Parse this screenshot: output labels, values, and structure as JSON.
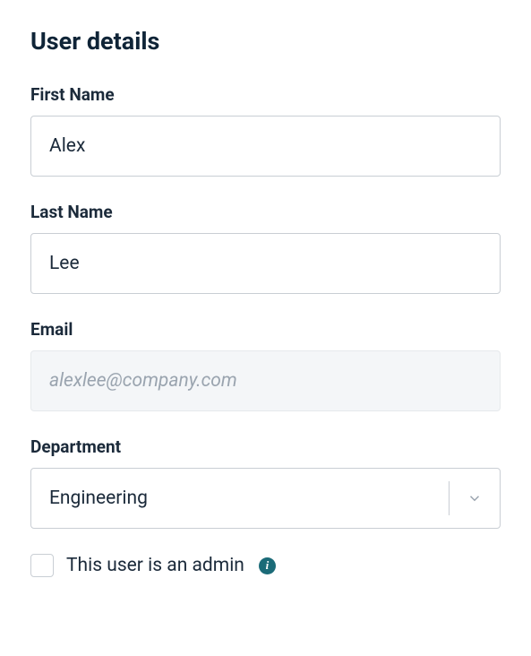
{
  "title": "User details",
  "fields": {
    "first_name": {
      "label": "First Name",
      "value": "Alex"
    },
    "last_name": {
      "label": "Last Name",
      "value": "Lee"
    },
    "email": {
      "label": "Email",
      "value": "alexlee@company.com"
    },
    "department": {
      "label": "Department",
      "value": "Engineering"
    }
  },
  "admin_checkbox": {
    "label": "This user is an admin",
    "checked": false
  }
}
